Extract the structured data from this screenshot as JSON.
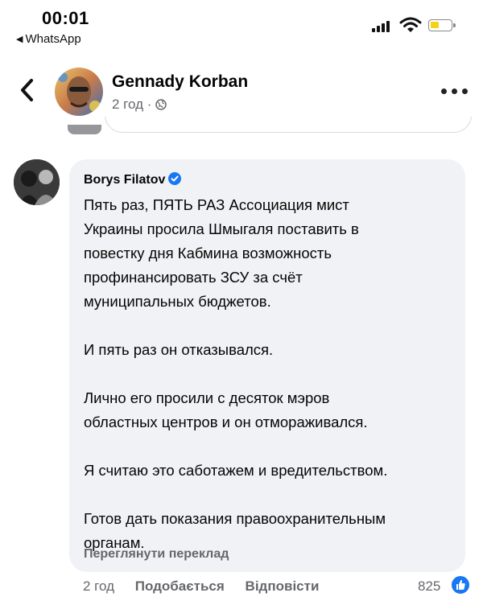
{
  "status_bar": {
    "time": "00:01",
    "back_app": "WhatsApp"
  },
  "header": {
    "page_name": "Gennady Korban",
    "post_time": "2 год",
    "separator": "·"
  },
  "comment": {
    "author": "Borys Filatov",
    "paragraphs": [
      "Пять раз, ПЯТЬ РАЗ Ассоциация мист\nУкраины просила Шмыгаля поставить в\nповестку дня Кабмина возможность\nпрофинансировать ЗСУ за счёт\nмуниципальных бюджетов.",
      "И пять раз он отказывался.",
      "Лично его просили с десяток мэров\nобластных центров и он отмораживался.",
      "Я считаю это саботажем и вредительством.",
      "Готов дать показания правоохранительным\nорганам."
    ],
    "translate_label": "Переглянути переклад",
    "time": "2 год",
    "like_label": "Подобається",
    "reply_label": "Відповісти",
    "reaction_count": "825"
  },
  "colors": {
    "bubble": "#f0f2f5",
    "meta_gray": "#65676b",
    "facebook_blue": "#1877f2",
    "battery_yellow": "#f3d31a"
  },
  "icons": [
    "back-chevron-icon",
    "globe-icon",
    "more-icon",
    "verified-icon",
    "like-reaction-icon",
    "signal-icon",
    "wifi-icon",
    "battery-icon"
  ]
}
